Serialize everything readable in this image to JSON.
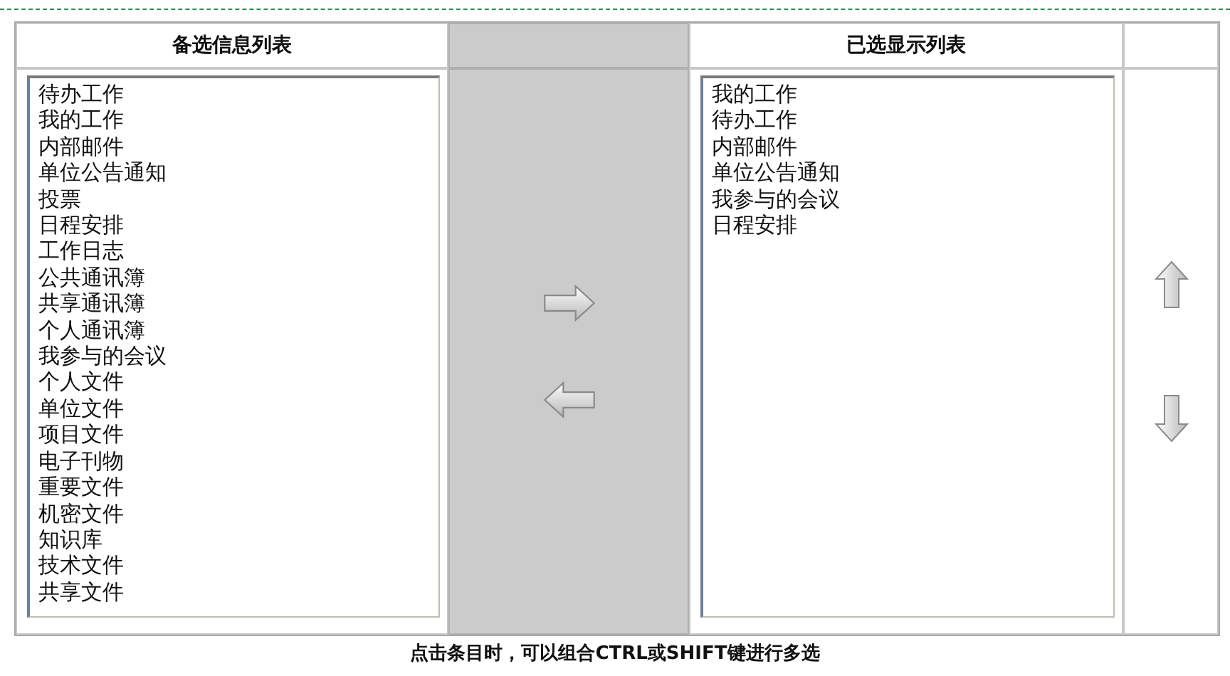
{
  "available": {
    "title": "备选信息列表",
    "items": [
      "待办工作",
      "我的工作",
      "内部邮件",
      "单位公告通知",
      "投票",
      "日程安排",
      "工作日志",
      "公共通讯簿",
      "共享通讯簿",
      "个人通讯簿",
      "我参与的会议",
      "个人文件",
      "单位文件",
      "项目文件",
      "电子刊物",
      "重要文件",
      "机密文件",
      "知识库",
      "技术文件",
      "共享文件"
    ]
  },
  "selected": {
    "title": "已选显示列表",
    "items": [
      "我的工作",
      "待办工作",
      "内部邮件",
      "单位公告通知",
      "我参与的会议",
      "日程安排"
    ]
  },
  "hint": "点击条目时，可以组合CTRL或SHIFT键进行多选"
}
